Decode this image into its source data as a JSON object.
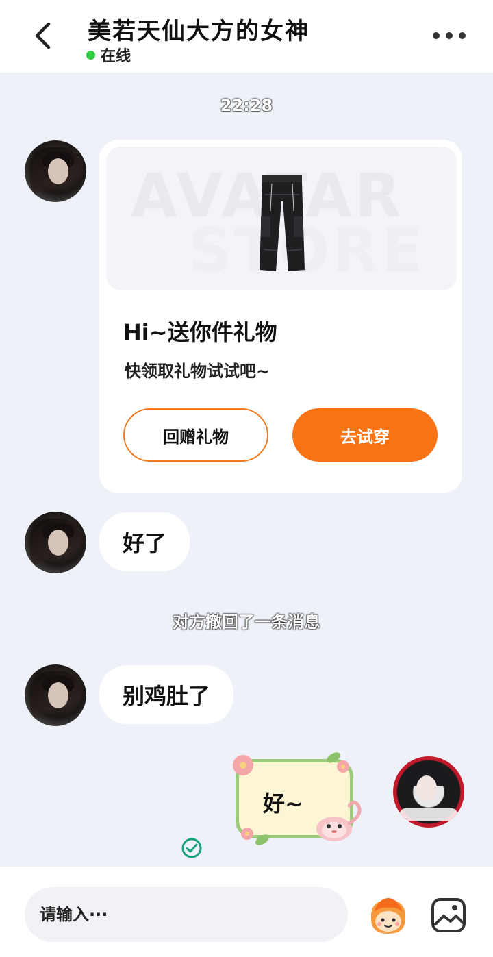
{
  "header": {
    "title": "美若天仙大方的女神",
    "status": "在线",
    "status_color": "#2ecc40"
  },
  "messages": {
    "timestamp": "22:28",
    "gift_card": {
      "watermark_line1": "AVATAR",
      "watermark_line2": "STORE",
      "title": "Hi~送你件礼物",
      "subtitle": "快领取礼物试试吧~",
      "return_button": "回赠礼物",
      "try_button": "去试穿"
    },
    "msg1": "好了",
    "recall_notice": "对方撤回了一条消息",
    "msg2": "别鸡肚了",
    "sent_sticker_text": "好~"
  },
  "input": {
    "placeholder": "请输入···"
  },
  "icons": {
    "back": "chevron-left-icon",
    "more": "more-dots-icon",
    "sent_status": "check-circle-icon",
    "emoji": "emoji-face-icon",
    "image": "image-icon"
  },
  "colors": {
    "accent": "#f97314",
    "background": "#eef1f7",
    "sent_check": "#1aa37a"
  }
}
